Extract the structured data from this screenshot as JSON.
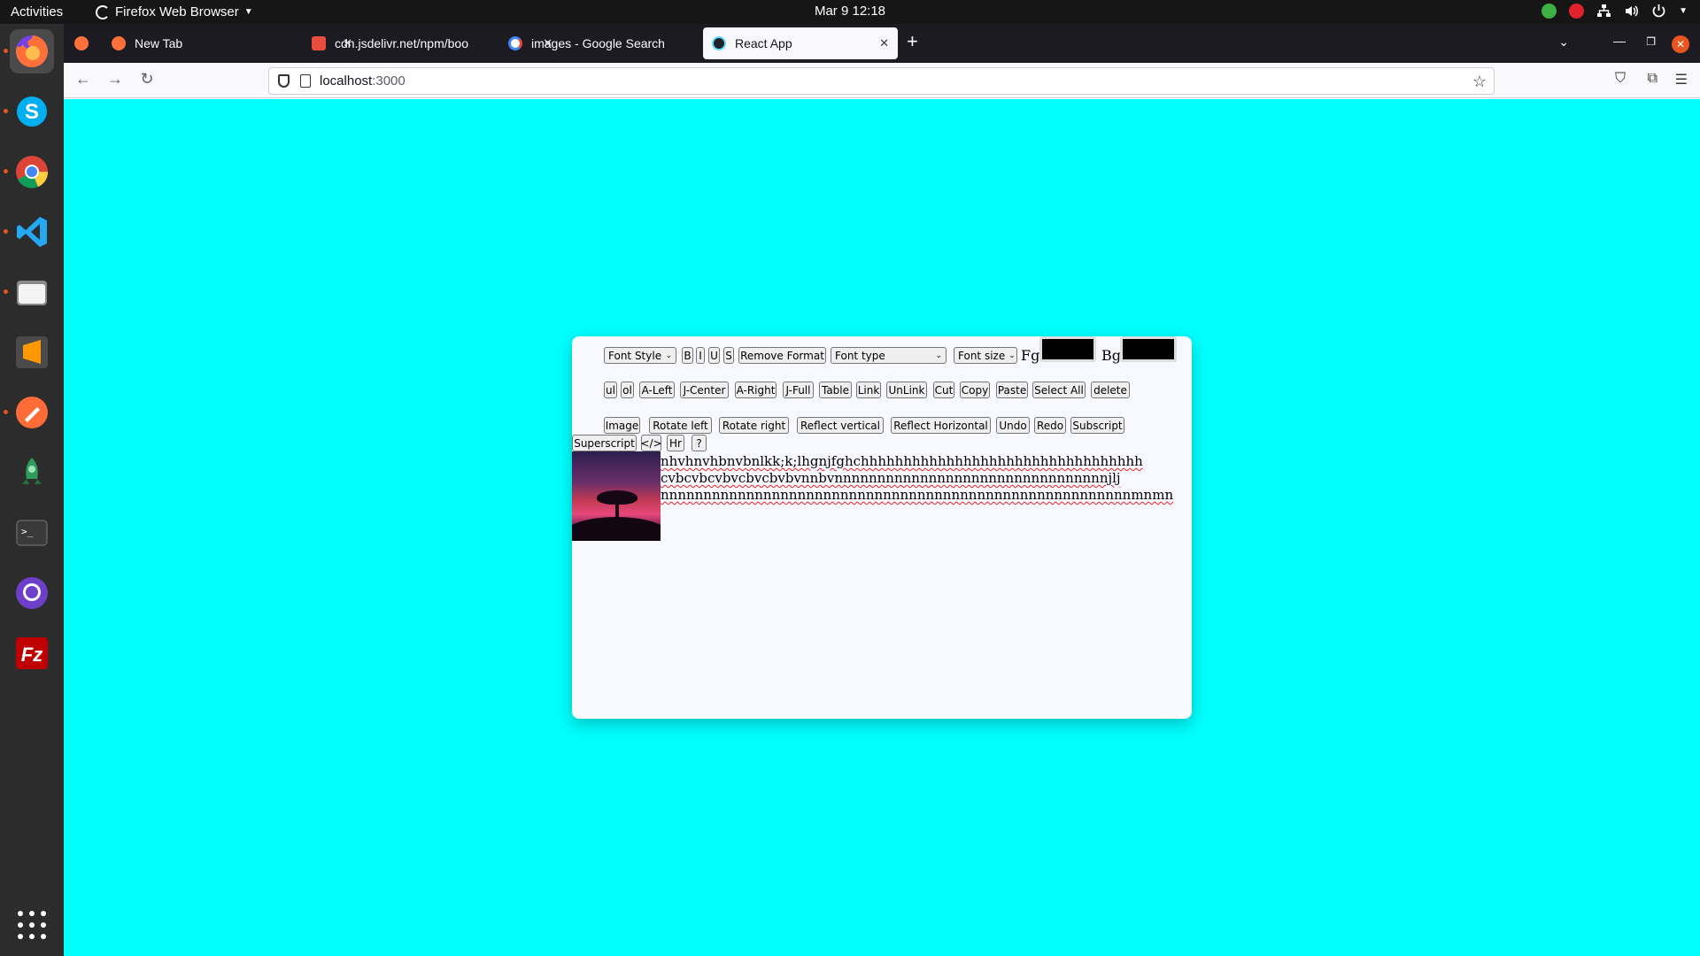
{
  "topbar": {
    "activities": "Activities",
    "app_name": "Firefox Web Browser",
    "clock": "Mar 9  12:18"
  },
  "dock": {
    "items": [
      "Firefox",
      "Skype",
      "Google Chrome",
      "Visual Studio Code",
      "Files",
      "Sublime Text",
      "Postman",
      "Robot 3T",
      "Terminal",
      "GitHub Desktop",
      "FileZilla"
    ]
  },
  "browser": {
    "tabs": [
      {
        "title": "New Tab",
        "active": false
      },
      {
        "title": "cdn.jsdelivr.net/npm/boo",
        "active": false
      },
      {
        "title": "images - Google Search",
        "active": false
      },
      {
        "title": "React App",
        "active": true
      }
    ],
    "url_host": "localhost",
    "url_port": ":3000"
  },
  "editor": {
    "toolbar_row1": {
      "font_style": "Font Style",
      "bold": "B",
      "italic": "I",
      "underline": "U",
      "strike": "S",
      "remove_format": "Remove Format",
      "font_type": "Font type",
      "font_size": "Font size",
      "fg_label": "Fg",
      "bg_label": "Bg",
      "fg_color": "#000000",
      "bg_color": "#000000"
    },
    "toolbar_row2": [
      "ul",
      "ol",
      "A-Left",
      "J-Center",
      "A-Right",
      "J-Full",
      "Table",
      "Link",
      "UnLink",
      "Cut",
      "Copy",
      "Paste",
      "Select All",
      "delete"
    ],
    "toolbar_row3": [
      "Image",
      "Rotate left",
      "Rotate right",
      "Reflect vertical",
      "Reflect Horizontal",
      "Undo",
      "Redo",
      "Subscript"
    ],
    "toolbar_row4": [
      "Superscript",
      "</>",
      "Hr",
      "?"
    ],
    "content_lines": [
      "nhvhnvhbnvbnlkk;k;lhgnjfghchhhhhhhhhhhhhhhhhhhhhhhhhhhhhhhhh",
      "cvbcvbcvbvcbvcbvbvnnbvnnnnnnnnnnnnnnnnnnnnnnnnnnnnnnnnjlj",
      "nnnnnnnnnnnnnnnnnnnnnnnnnnnnnnnnnnnnnnnnnnnnnnnnnnnnnnnmnmn"
    ]
  }
}
